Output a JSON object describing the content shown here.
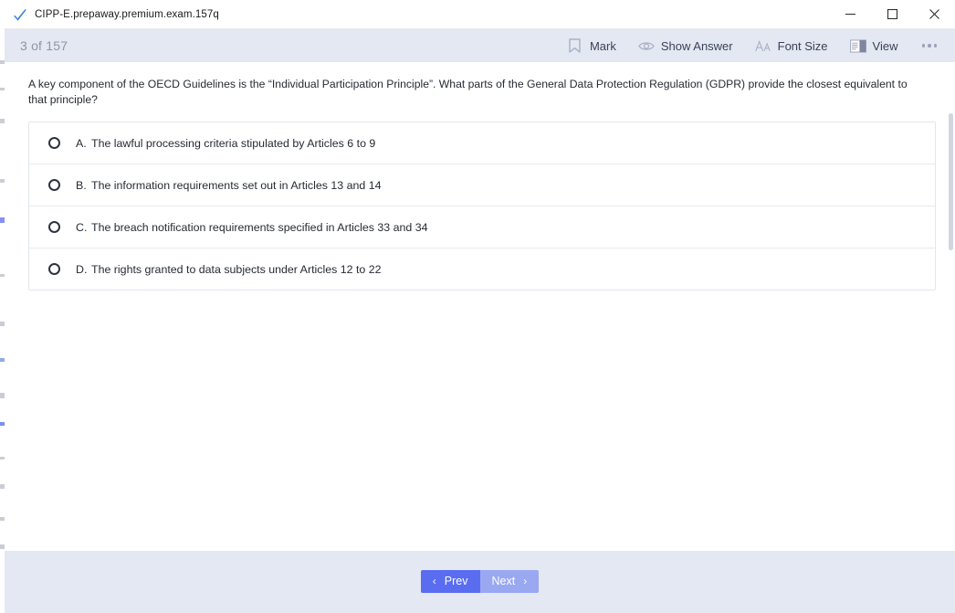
{
  "window": {
    "title": "CIPP-E.prepaway.premium.exam.157q",
    "app_icon": "blue-check-icon",
    "controls": {
      "minimize": "–",
      "maximize": "☐",
      "close": "✕"
    }
  },
  "header": {
    "counter": "3 of 157",
    "toolbar": [
      {
        "id": "mark",
        "label": "Mark",
        "icon": "bookmark-icon"
      },
      {
        "id": "show-answer",
        "label": "Show Answer",
        "icon": "eye-icon"
      },
      {
        "id": "font-size",
        "label": "Font Size",
        "icon": "font-size-icon"
      },
      {
        "id": "view",
        "label": "View",
        "icon": "layout-view-icon"
      }
    ],
    "more_label": "More options"
  },
  "question": {
    "text": "A key component of the OECD Guidelines is the “Individual Participation Principle”. What parts of the General Data Protection Regulation (GDPR) provide the closest equivalent to that principle?",
    "selected": null,
    "options": [
      {
        "letter": "A.",
        "text": "The lawful processing criteria stipulated by Articles 6 to 9"
      },
      {
        "letter": "B.",
        "text": "The information requirements set out in Articles 13 and 14"
      },
      {
        "letter": "C.",
        "text": "The breach notification requirements specified in Articles 33 and 34"
      },
      {
        "letter": "D.",
        "text": "The rights granted to data subjects under Articles 12 to 22"
      }
    ]
  },
  "footer": {
    "prev_label": "Prev",
    "next_label": "Next",
    "prev_chevron": "‹",
    "next_chevron": "›"
  },
  "colors": {
    "header_bg": "#e4e8f2",
    "prev_button": "#5a6df0",
    "next_button": "#9aa8f2",
    "text": "#262b33",
    "counter_text": "#8f95a6"
  }
}
